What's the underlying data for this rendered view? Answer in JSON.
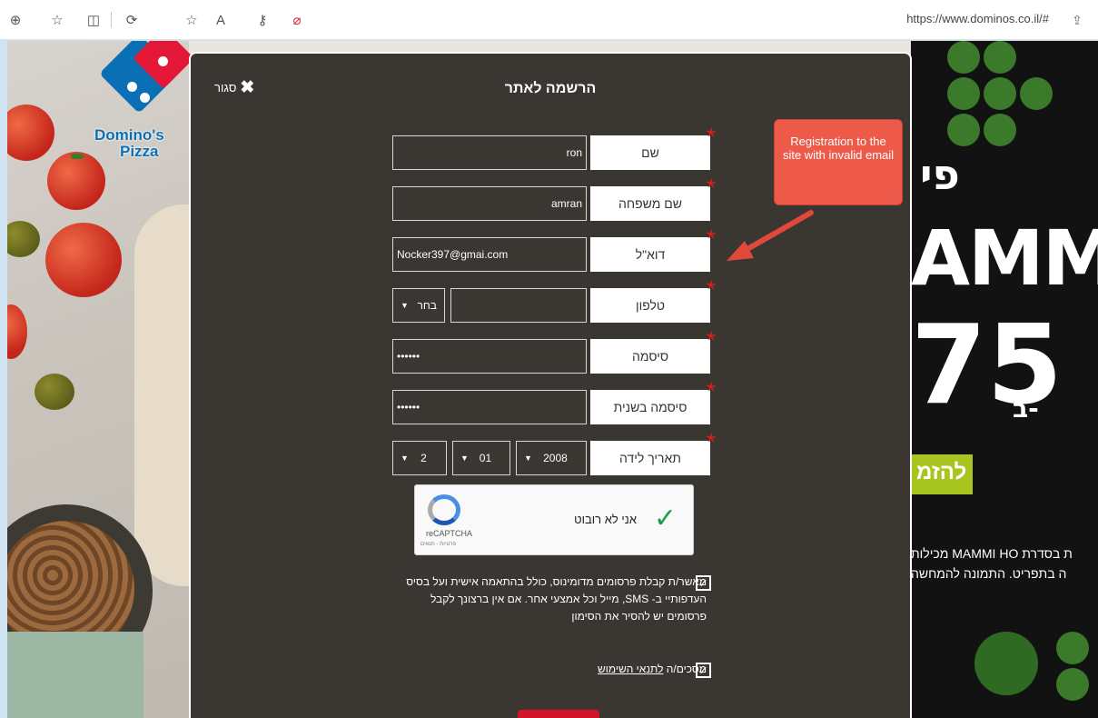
{
  "browser": {
    "url": "https://www.dominos.co.il/#"
  },
  "brand": {
    "logo_text_line1": "Domino's",
    "logo_text_line2": "Pizza"
  },
  "background_promo": {
    "big_text_1": "פי",
    "big_text_2": "AMM",
    "big_text_3": "75",
    "big_text_4": "ב-",
    "button_label": "להזמ",
    "line_1": "ת בסדרת MAMMI HO מכילות",
    "line_2": "ה בתפריט. התמונה להמחשה"
  },
  "modal": {
    "close_label": "סגור",
    "title": "הרשמה לאתר",
    "fields": {
      "first_name": {
        "label": "שם",
        "value": "ron"
      },
      "last_name": {
        "label": "שם משפחה",
        "value": "amran"
      },
      "email": {
        "label": "דוא\"ל",
        "value": "Nocker397@gmai.com"
      },
      "phone": {
        "label": "טלפון",
        "value": "",
        "prefix_selected": "בחר"
      },
      "password": {
        "label": "סיסמה",
        "value": "••••••"
      },
      "password_repeat": {
        "label": "סיסמה בשנית",
        "value": "••••••"
      },
      "birthdate": {
        "label": "תאריך לידה",
        "day": "2",
        "month": "01",
        "year": "2008"
      }
    },
    "captcha": {
      "text": "אני לא רובוט",
      "brand": "reCAPTCHA",
      "links": "פרטיות - תנאים"
    },
    "consent_text": "מאשר/ת קבלת פרסומים מדומינוס, כולל בהתאמה אישית ועל בסיס העדפותיי ב- SMS, מייל וכל אמצעי אחר. אם אין ברצונך לקבל פרסומים יש להסיר את הסימון",
    "terms_prefix": "מסכים/ה",
    "terms_link": "לתנאי השימוש"
  },
  "annotation": {
    "text": "Registration to the site with invalid email",
    "color": "#ee5a4a"
  }
}
